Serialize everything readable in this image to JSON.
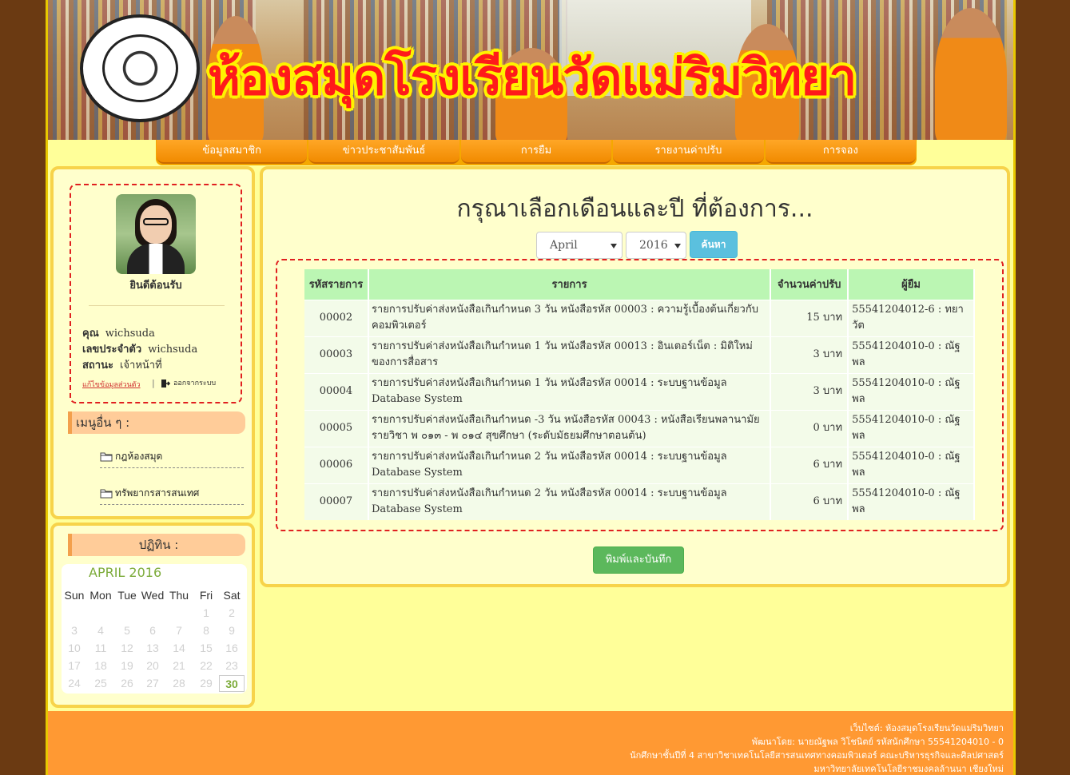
{
  "header": {
    "site_title": "ห้องสมุดโรงเรียนวัดแม่ริมวิทยา"
  },
  "nav": [
    {
      "label": "ข้อมูลสมาชิก"
    },
    {
      "label": "ข่าวประชาสัมพันธ์"
    },
    {
      "label": "การยืม"
    },
    {
      "label": "รายงานค่าปรับ"
    },
    {
      "label": "การจอง"
    }
  ],
  "profile": {
    "welcome": "ยินดีต้อนรับ",
    "name_label": "คุณ",
    "name_value": "wichsuda",
    "id_label": "เลขประจำตัว",
    "id_value": "wichsuda",
    "status_label": "สถานะ",
    "status_value": "เจ้าหน้าที่",
    "edit_link": "แก้ไขข้อมูลส่วนตัว",
    "separator": "|",
    "logout_label": "ออกจากระบบ"
  },
  "menu": {
    "header": "เมนูอื่น ๆ :",
    "items": [
      {
        "label": "กฎห้องสมุด",
        "icon": "folder-icon"
      },
      {
        "label": "ทรัพยากรสารสนเทศ",
        "icon": "folder-icon"
      }
    ]
  },
  "calendar": {
    "header": "ปฏิทิน :",
    "month_title": "APRIL 2016",
    "days_of_week": [
      "Sun",
      "Mon",
      "Tue",
      "Wed",
      "Thu",
      "Fri",
      "Sat"
    ],
    "first_weekday": 5,
    "days_in_month": 30,
    "today": 30
  },
  "main": {
    "title": "กรุณาเลือกเดือนและปี ที่ต้องการ...",
    "month_select": "April",
    "year_select": "2016",
    "search_button": "ค้นหา",
    "print_button": "พิมพ์และบันทึก",
    "table": {
      "headers": [
        "รหัสรายการ",
        "รายการ",
        "จำนวนค่าปรับ",
        "ผู้ยืม"
      ],
      "rows": [
        {
          "id": "00002",
          "desc": "รายการปรับค่าส่งหนังสือเกินกำหนด 3 วัน หนังสือรหัส 00003 : ความรู้เบื้องต้นเกี่ยวกับคอมพิวเตอร์",
          "amount": "15 บาท",
          "borrower": "55541204012-6 : ทยาวัต"
        },
        {
          "id": "00003",
          "desc": "รายการปรับค่าส่งหนังสือเกินกำหนด 1 วัน หนังสือรหัส 00013 : อินเตอร์เน็ต : มิติใหม่ของการสื่อสาร",
          "amount": "3 บาท",
          "borrower": "55541204010-0 : ณัฐพล"
        },
        {
          "id": "00004",
          "desc": "รายการปรับค่าส่งหนังสือเกินกำหนด 1 วัน หนังสือรหัส 00014 : ระบบฐานข้อมูล Database System",
          "amount": "3 บาท",
          "borrower": "55541204010-0 : ณัฐพล"
        },
        {
          "id": "00005",
          "desc": "รายการปรับค่าส่งหนังสือเกินกำหนด -3 วัน หนังสือรหัส 00043 : หนังสือเรียนพลานามัย รายวิชา พ ๐๑๓ - พ ๐๑๔ สุขศึกษา (ระดับมัธยมศึกษาตอนต้น)",
          "amount": "0 บาท",
          "borrower": "55541204010-0 : ณัฐพล"
        },
        {
          "id": "00006",
          "desc": "รายการปรับค่าส่งหนังสือเกินกำหนด 2 วัน หนังสือรหัส 00014 : ระบบฐานข้อมูล Database System",
          "amount": "6 บาท",
          "borrower": "55541204010-0 : ณัฐพล"
        },
        {
          "id": "00007",
          "desc": "รายการปรับค่าส่งหนังสือเกินกำหนด 2 วัน หนังสือรหัส 00014 : ระบบฐานข้อมูล Database System",
          "amount": "6 บาท",
          "borrower": "55541204010-0 : ณัฐพล"
        }
      ]
    }
  },
  "footer": {
    "lines": [
      "เว็บไซต์: ห้องสมุดโรงเรียนวัดแม่ริมวิทยา",
      "พัฒนาโดย: นายณัฐพล วิโชนิตย์ รหัสนักศึกษา 55541204010 - 0",
      "นักศึกษาชั้นปีที่ 4 สาขาวิชาเทคโนโลยีสารสนเทศทางคอมพิวเตอร์ คณะบริหารธุรกิจและศิลปศาสตร์",
      "มหาวิทยาลัยเทคโนโลยีราชมงคลล้านนา เชียงใหม่"
    ]
  },
  "colors": {
    "page_bg": "#6b3a12",
    "content_bg": "#ffff99",
    "nav_orange": "#f18b00",
    "footer_orange": "#ff9933",
    "table_header": "#bbf6b3",
    "search_btn": "#5bc0de",
    "print_btn": "#5cb85c",
    "dashed_border": "#e02020"
  }
}
